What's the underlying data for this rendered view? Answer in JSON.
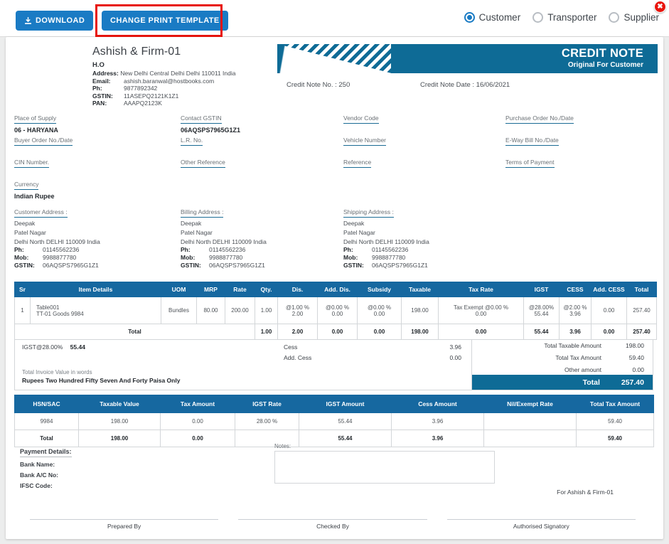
{
  "toolbar": {
    "download_label": "DOWNLOAD",
    "change_template_label": "CHANGE PRINT TEMPLATE",
    "close_label": "✖",
    "radios": [
      {
        "label": "Customer",
        "selected": true
      },
      {
        "label": "Transporter",
        "selected": false
      },
      {
        "label": "Supplier",
        "selected": false
      }
    ]
  },
  "document": {
    "company": {
      "name": "Ashish & Firm-01",
      "branch": "H.O",
      "address_label": "Address:",
      "address": "New Delhi Central Delhi Delhi 110011 India",
      "rows": [
        {
          "key": "Email:",
          "value": "ashish.baranwal@hostbooks.com"
        },
        {
          "key": "Ph:",
          "value": "9877892342"
        },
        {
          "key": "GSTIN:",
          "value": "11ASEPQ2121K1Z1"
        },
        {
          "key": "PAN:",
          "value": "AAAPQ2123K"
        }
      ]
    },
    "banner": {
      "title": "CREDIT NOTE",
      "subtitle": "Original For Customer"
    },
    "note_no": "Credit Note No. : 250",
    "note_date": "Credit Note Date : 16/06/2021",
    "fields": [
      {
        "label": "Place of Supply",
        "value": "06 - HARYANA"
      },
      {
        "label": "Contact GSTIN",
        "value": "06AQSPS7965G1Z1"
      },
      {
        "label": "Vendor Code",
        "value": ""
      },
      {
        "label": "Purchase Order No./Date",
        "value": ""
      },
      {
        "label": "Buyer Order No./Date",
        "value": ""
      },
      {
        "label": "L.R. No.",
        "value": ""
      },
      {
        "label": "Vehicle Number",
        "value": ""
      },
      {
        "label": "E-Way Bill No./Date",
        "value": ""
      },
      {
        "label": "CIN Number.",
        "value": ""
      },
      {
        "label": "Other Reference",
        "value": ""
      },
      {
        "label": "Reference",
        "value": ""
      },
      {
        "label": "Terms of Payment",
        "value": ""
      },
      {
        "label": "Currency",
        "value": "Indian Rupee"
      }
    ],
    "addresses": [
      {
        "heading": "Customer Address :",
        "name": "Deepak",
        "street": "Patel Nagar",
        "city": "Delhi North DELHI 110009 India",
        "rows": [
          {
            "key": "Ph:",
            "value": "01145562236"
          },
          {
            "key": "Mob:",
            "value": "9988877780"
          },
          {
            "key": "GSTIN:",
            "value": "06AQSPS7965G1Z1"
          }
        ]
      },
      {
        "heading": "Billing Address :",
        "name": "Deepak",
        "street": "Patel Nagar",
        "city": "Delhi North DELHI 110009 India",
        "rows": [
          {
            "key": "Ph:",
            "value": "01145562236"
          },
          {
            "key": "Mob:",
            "value": "9988877780"
          },
          {
            "key": "GSTIN:",
            "value": "06AQSPS7965G1Z1"
          }
        ]
      },
      {
        "heading": "Shipping Address :",
        "name": "Deepak",
        "street": "Patel Nagar",
        "city": "Delhi North DELHI 110009 India",
        "rows": [
          {
            "key": "Ph:",
            "value": "01145562236"
          },
          {
            "key": "Mob:",
            "value": "9988877780"
          },
          {
            "key": "GSTIN:",
            "value": "06AQSPS7965G1Z1"
          }
        ]
      }
    ],
    "items_table": {
      "headers": [
        "Sr",
        "Item Details",
        "UOM",
        "MRP",
        "Rate",
        "Qty.",
        "Dis.",
        "Add. Dis.",
        "Subsidy",
        "Taxable",
        "Tax Rate",
        "IGST",
        "CESS",
        "Add. CESS",
        "Total"
      ],
      "row": {
        "sr": "1",
        "item_name": "Table001",
        "item_sub": "TT-01 Goods 9984",
        "uom": "Bundles",
        "mrp": "80.00",
        "rate": "200.00",
        "qty": "1.00",
        "dis_pct": "@1.00 %",
        "dis_amt": "2.00",
        "adddis_pct": "@0.00 %",
        "adddis_amt": "0.00",
        "subsidy_pct": "@0.00 %",
        "subsidy_amt": "0.00",
        "taxable": "198.00",
        "taxrate_pct": "Tax Exempt @0.00 %",
        "taxrate_amt": "0.00",
        "igst_pct": "@28.00%",
        "igst_amt": "55.44",
        "cess_pct": "@2.00 %",
        "cess_amt": "3.96",
        "add_cess": "0.00",
        "total": "257.40"
      },
      "total_row": {
        "label": "Total",
        "qty": "1.00",
        "dis": "2.00",
        "add_dis": "0.00",
        "subsidy": "0.00",
        "taxable": "198.00",
        "tax_rate": "0.00",
        "igst": "55.44",
        "cess": "3.96",
        "add_cess": "0.00",
        "total": "257.40"
      }
    },
    "summary": {
      "igst_label": "IGST@28.00%",
      "igst_value": "55.44",
      "cess_rows": [
        {
          "label": "Cess",
          "value": "3.96"
        },
        {
          "label": "Add. Cess",
          "value": "0.00"
        }
      ],
      "words_label": "Total Invoice Value in words",
      "words_value": "Rupees Two Hundred Fifty Seven And Forty Paisa Only",
      "right_rows": [
        {
          "label": "Total Taxable Amount",
          "value": "198.00"
        },
        {
          "label": "Total Tax Amount",
          "value": "59.40"
        },
        {
          "label": "Other amount",
          "value": "0.00"
        }
      ],
      "total_label": "Total",
      "total_value": "257.40"
    },
    "hsn_table": {
      "headers": [
        "HSN/SAC",
        "Taxable Value",
        "Tax Amount",
        "IGST Rate",
        "IGST Amount",
        "Cess Amount",
        "Nil/Exempt Rate",
        "Total Tax Amount"
      ],
      "rows": [
        [
          "9984",
          "198.00",
          "0.00",
          "28.00 %",
          "55.44",
          "3.96",
          "",
          "59.40"
        ]
      ],
      "total_row": [
        "Total",
        "198.00",
        "0.00",
        "",
        "55.44",
        "3.96",
        "",
        "59.40"
      ]
    },
    "payment": {
      "heading": "Payment Details:",
      "lines": [
        "Bank Name:",
        "Bank A/C No:",
        "IFSC Code:"
      ]
    },
    "notes_label": "Notes:",
    "notes_value": "",
    "for_firm": "For Ashish & Firm-01",
    "signatures": [
      "Prepared By",
      "Checked By",
      "Authorised Signatory"
    ]
  },
  "colors": {
    "brand_blue": "#1a7bc4",
    "banner_blue": "#0e6b96",
    "table_header": "#1668a0",
    "highlight_red": "#e8140c"
  }
}
